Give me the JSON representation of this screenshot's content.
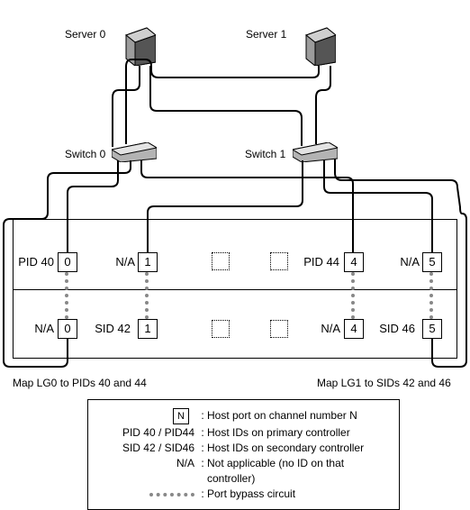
{
  "servers": [
    {
      "label": "Server 0"
    },
    {
      "label": "Server 1"
    }
  ],
  "switches": [
    {
      "label": "Switch 0"
    },
    {
      "label": "Switch 1"
    }
  ],
  "top_row": {
    "ports": [
      {
        "id": "PID 40",
        "num": "0"
      },
      {
        "id": "N/A",
        "num": "1"
      },
      {
        "id": "PID 44",
        "num": "4"
      },
      {
        "id": "N/A",
        "num": "5"
      }
    ]
  },
  "bottom_row": {
    "ports": [
      {
        "id": "N/A",
        "num": "0"
      },
      {
        "id": "SID 42",
        "num": "1"
      },
      {
        "id": "N/A",
        "num": "4"
      },
      {
        "id": "SID 46",
        "num": "5"
      }
    ]
  },
  "maps": {
    "left": "Map LG0 to PIDs 40 and 44",
    "right": "Map LG1 to SIDs 42 and 46"
  },
  "legend": {
    "port_symbol": "N",
    "rows": [
      {
        "key": "[N]",
        "desc": "Host port on channel number N"
      },
      {
        "key": "PID 40 / PID44",
        "desc": "Host IDs on primary controller"
      },
      {
        "key": "SID 42 / SID46",
        "desc": "Host IDs on secondary controller"
      },
      {
        "key": "N/A",
        "desc": "Not applicable (no ID on that controller)"
      },
      {
        "key": "[bypass]",
        "desc": "Port bypass circuit"
      }
    ]
  }
}
